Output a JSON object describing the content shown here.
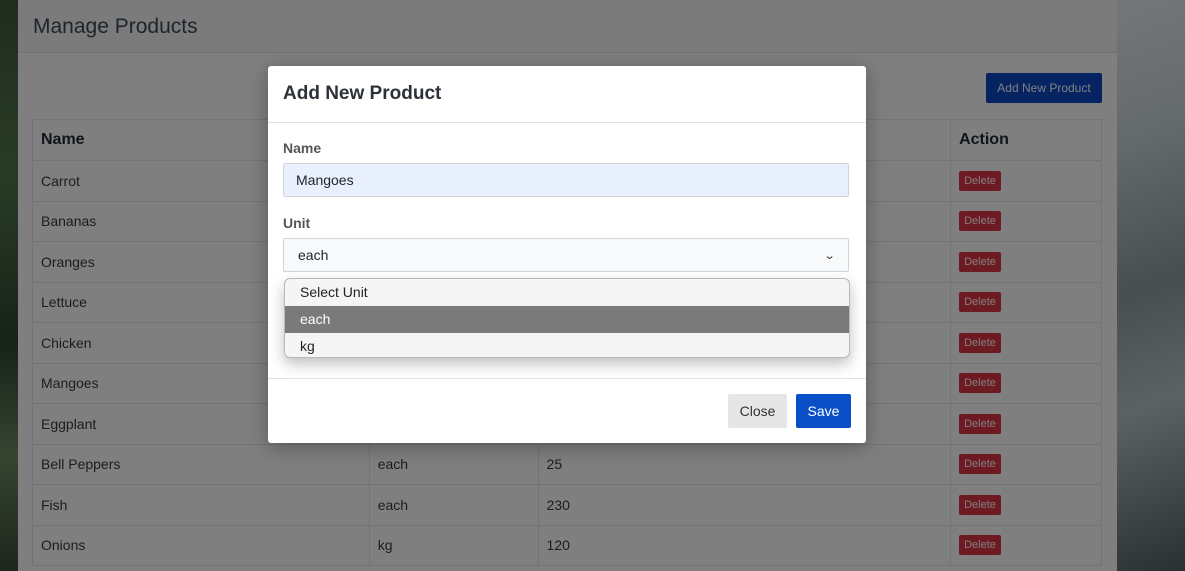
{
  "page": {
    "title": "Manage Products",
    "add_button": "Add New Product"
  },
  "table": {
    "headers": [
      "Name",
      "",
      "",
      "Action"
    ],
    "rows": [
      {
        "name": "Carrot",
        "unit": "",
        "price": ""
      },
      {
        "name": "Bananas",
        "unit": "",
        "price": ""
      },
      {
        "name": "Oranges",
        "unit": "",
        "price": ""
      },
      {
        "name": "Lettuce",
        "unit": "",
        "price": ""
      },
      {
        "name": "Chicken",
        "unit": "",
        "price": ""
      },
      {
        "name": "Mangoes",
        "unit": "",
        "price": ""
      },
      {
        "name": "Eggplant",
        "unit": "",
        "price": ""
      },
      {
        "name": "Bell Peppers",
        "unit": "each",
        "price": "25"
      },
      {
        "name": "Fish",
        "unit": "each",
        "price": "230"
      },
      {
        "name": "Onions",
        "unit": "kg",
        "price": "120"
      }
    ],
    "delete_label": "Delete"
  },
  "modal": {
    "title": "Add New Product",
    "name_label": "Name",
    "name_value": "Mangoes",
    "unit_label": "Unit",
    "unit_value": "each",
    "unit_options": [
      "Select Unit",
      "each",
      "kg"
    ],
    "selected_option": "each",
    "close_button": "Close",
    "save_button": "Save"
  },
  "icons": {
    "select": "chevron-down-icon"
  },
  "colors": {
    "primary": "#0b4fc8",
    "danger": "#dc3545",
    "overlay": "rgba(0,0,0,0.5)"
  }
}
